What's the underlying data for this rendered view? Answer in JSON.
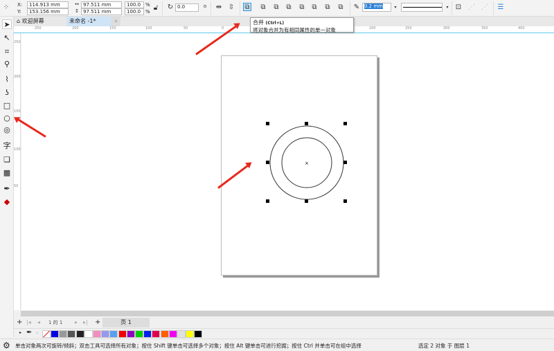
{
  "propbar": {
    "x_label": "X:",
    "x_value": "114.913 mm",
    "y_label": "Y:",
    "y_value": "153.156 mm",
    "width_value": "97.511 mm",
    "height_value": "97.511 mm",
    "scale_w": "100.0",
    "scale_h": "100.0",
    "pct": "%",
    "rotation": "0.0",
    "outline_width": "0.2 mm"
  },
  "tabs": {
    "welcome": "欢迎屏幕",
    "doc": "未命名 -1*",
    "add": "+"
  },
  "tooltip": {
    "title": "合并",
    "shortcut": "(Ctrl+L)",
    "desc": "将对象合并为有相同属性的单一对象"
  },
  "ruler": {
    "h_labels": [
      "250",
      "200",
      "150",
      "100",
      "50",
      "0",
      "200",
      "250",
      "300",
      "350",
      "400"
    ],
    "v_labels": [
      "250",
      "200",
      "150",
      "100",
      "50"
    ]
  },
  "pagenav": {
    "page_of": "1 的 1",
    "page_tab": "页 1"
  },
  "palette": {
    "colors": [
      "#0000e0",
      "#999999",
      "#555555",
      "#222222",
      "#ffffff",
      "#f48cc0",
      "#9898f0",
      "#5aa0f0",
      "#f00000",
      "#9000c0",
      "#00d000",
      "#0020f0",
      "#e00050",
      "#ff6000",
      "#f000f0",
      "#e0e0e0",
      "#ffff00",
      "#000000"
    ]
  },
  "status": {
    "hint": "单击对象两次可旋转/倾斜；双击工具可选择所有对象；按住 Shift 键单击可选择多个对象；按住 Alt 键单击可进行挖掘；按住 Ctrl 并单击可在组中选择",
    "selection": "选定 2 对象 于 图层 1"
  },
  "accent": "#e8281c"
}
